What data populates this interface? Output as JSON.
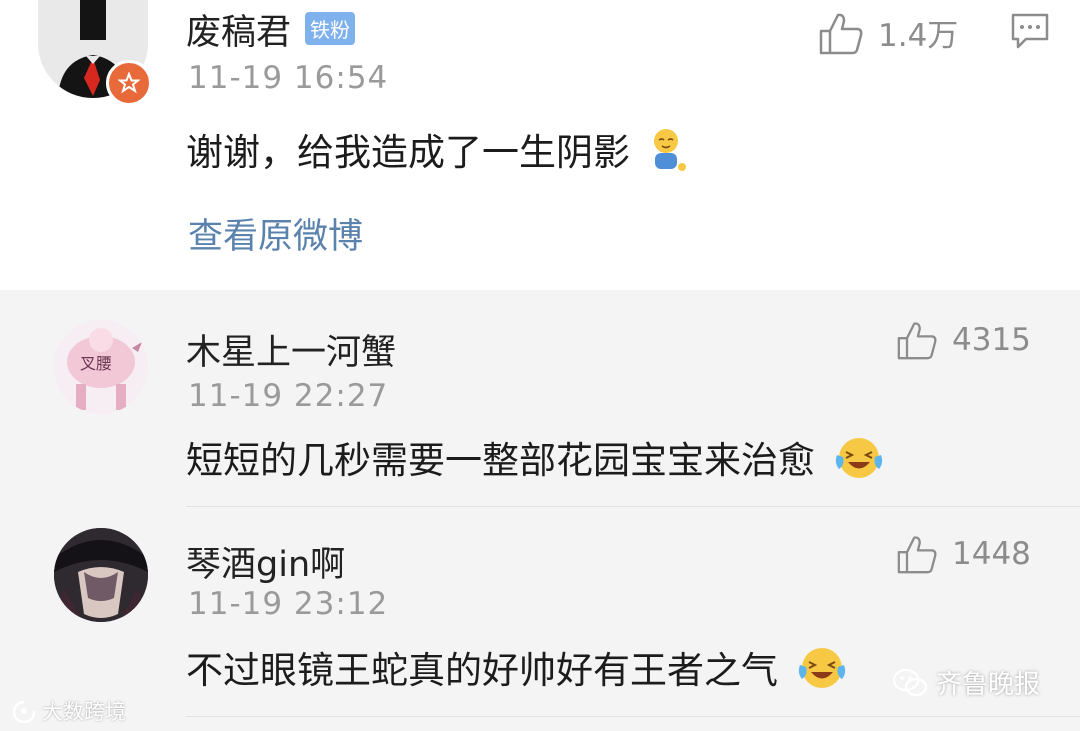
{
  "comments": [
    {
      "username": "废稿君",
      "badge": "铁粉",
      "time": "11-19 16:54",
      "text": "谢谢，给我造成了一生阴影",
      "likes": "1.4万",
      "link": "查看原微博",
      "emoji": "shy-emoji"
    },
    {
      "username": "木星上一河蟹",
      "time": "11-19 22:27",
      "text": "短短的几秒需要一整部花园宝宝来治愈",
      "likes": "4315",
      "avatar_text": "叉腰",
      "emoji": "laugh-cry-emoji"
    },
    {
      "username": "琴酒gin啊",
      "time": "11-19 23:12",
      "text": "不过眼镜王蛇真的好帅好有王者之气",
      "likes": "1448",
      "emoji": "laugh-cry-emoji"
    }
  ],
  "watermarks": {
    "left": "大数跨境",
    "right": "齐鲁晚报"
  },
  "colors": {
    "link": "#5a82ad",
    "badge": "#7fb1ec",
    "subcomment_bg": "#f4f4f4"
  }
}
